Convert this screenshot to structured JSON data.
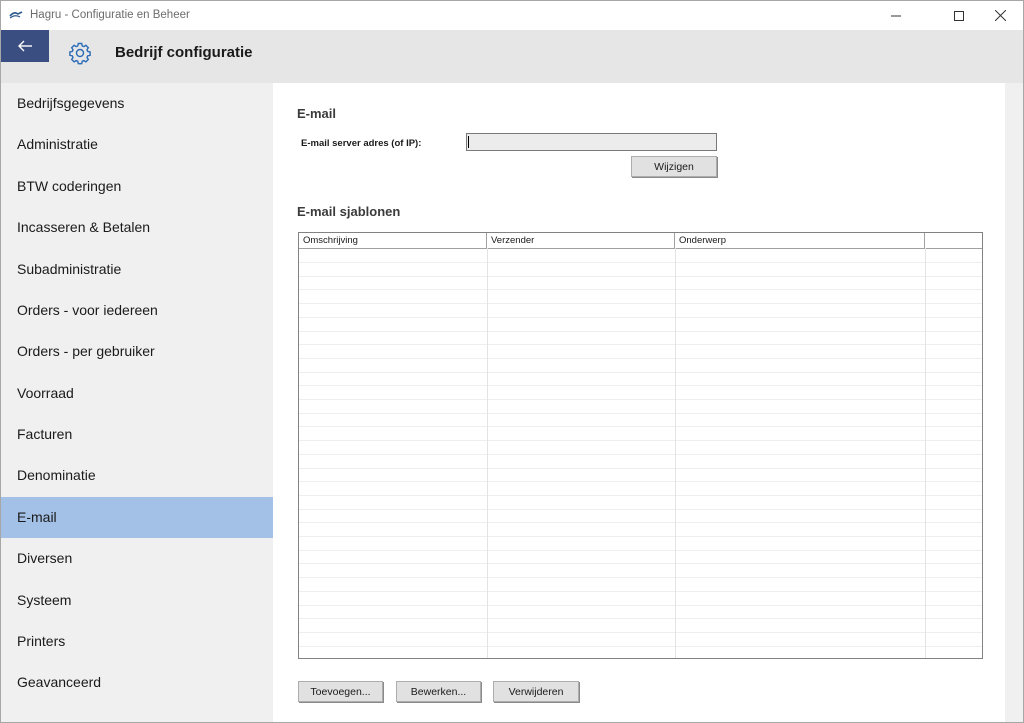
{
  "window": {
    "title": "Hagru - Configuratie en Beheer"
  },
  "header": {
    "title": "Bedrijf configuratie"
  },
  "sidebar": {
    "items": [
      {
        "label": "Bedrijfsgegevens",
        "active": false
      },
      {
        "label": "Administratie",
        "active": false
      },
      {
        "label": "BTW coderingen",
        "active": false
      },
      {
        "label": "Incasseren & Betalen",
        "active": false
      },
      {
        "label": "Subadministratie",
        "active": false
      },
      {
        "label": "Orders - voor iedereen",
        "active": false
      },
      {
        "label": "Orders - per gebruiker",
        "active": false
      },
      {
        "label": "Voorraad",
        "active": false
      },
      {
        "label": "Facturen",
        "active": false
      },
      {
        "label": "Denominatie",
        "active": false
      },
      {
        "label": "E-mail",
        "active": true
      },
      {
        "label": "Diversen",
        "active": false
      },
      {
        "label": "Systeem",
        "active": false
      },
      {
        "label": "Printers",
        "active": false
      },
      {
        "label": "Geavanceerd",
        "active": false
      }
    ]
  },
  "email": {
    "section_title": "E-mail",
    "server_label": "E-mail server adres (of IP):",
    "server_value": "",
    "change_button": "Wijzigen"
  },
  "templates": {
    "section_title": "E-mail sjablonen",
    "columns": [
      "Omschrijving",
      "Verzender",
      "Onderwerp",
      ""
    ],
    "rows": [],
    "buttons": {
      "add": "Toevoegen...",
      "edit": "Bewerken...",
      "delete": "Verwijderen"
    }
  },
  "colors": {
    "accent": "#3a4e82",
    "active_nav": "#a3c1e6",
    "header_bg": "#e6e6e6",
    "sidebar_bg": "#f0f0f0"
  }
}
